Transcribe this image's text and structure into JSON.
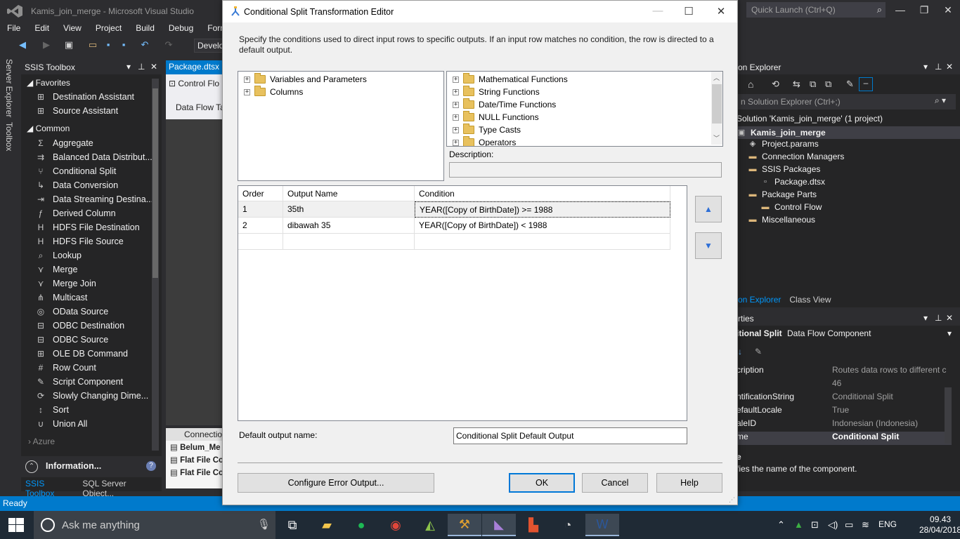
{
  "vs": {
    "title": "Kamis_join_merge - Microsoft Visual Studio",
    "quick_launch_placeholder": "Quick Launch (Ctrl+Q)",
    "menu": [
      "File",
      "Edit",
      "View",
      "Project",
      "Build",
      "Debug",
      "Form"
    ],
    "toolbar_config": "Develo",
    "side_tabs": [
      "Server Explorer",
      "Toolbox"
    ],
    "status": "Ready"
  },
  "toolbox": {
    "title": "SSIS Toolbox",
    "favorites_label": "Favorites",
    "favorites": [
      "Destination Assistant",
      "Source Assistant"
    ],
    "common_label": "Common",
    "common": [
      "Aggregate",
      "Balanced Data Distribut...",
      "Conditional Split",
      "Data Conversion",
      "Data Streaming Destina...",
      "Derived Column",
      "HDFS File Destination",
      "HDFS File Source",
      "Lookup",
      "Merge",
      "Merge Join",
      "Multicast",
      "OData Source",
      "ODBC Destination",
      "ODBC Source",
      "OLE DB Command",
      "Row Count",
      "Script Component",
      "Slowly Changing Dime...",
      "Sort",
      "Union All"
    ],
    "azure_label": "Azure",
    "info_label": "Information...",
    "bottom_tabs": [
      "SSIS Toolbox",
      "SQL Server Object..."
    ]
  },
  "package": {
    "tab": "Package.dtsx [",
    "control_flow": "Control Flo",
    "data_flow": "Data Flow Ta",
    "connections_label": "Connection",
    "connections": [
      "Belum_Me",
      "Flat File Co",
      "Flat File Co"
    ]
  },
  "solution": {
    "title": "on Explorer",
    "search_placeholder": "n Solution Explorer (Ctrl+;)",
    "items": [
      {
        "label": "Solution 'Kamis_join_merge' (1 project)"
      },
      {
        "label": "Kamis_join_merge"
      },
      {
        "label": "Project.params"
      },
      {
        "label": "Connection Managers"
      },
      {
        "label": "SSIS Packages"
      },
      {
        "label": "Package.dtsx"
      },
      {
        "label": "Package Parts"
      },
      {
        "label": "Control Flow"
      },
      {
        "label": "Miscellaneous"
      }
    ],
    "tabs": [
      "on Explorer",
      "Class View"
    ]
  },
  "properties": {
    "title": "rties",
    "object_name": "itional Split",
    "object_type": "Data Flow Component",
    "rows": [
      {
        "name": "cription",
        "value": "Routes data rows to different c"
      },
      {
        "name": "",
        "value": "46"
      },
      {
        "name": "ntificationString",
        "value": "Conditional Split"
      },
      {
        "name": "efaultLocale",
        "value": "True"
      },
      {
        "name": "aleID",
        "value": "Indonesian (Indonesia)"
      },
      {
        "name": "me",
        "value": "Conditional Split"
      }
    ],
    "help_title": "e",
    "help_text": "fies the name of the component."
  },
  "taskbar": {
    "search_placeholder": "Ask me anything",
    "lang": "ENG",
    "time": "09.43",
    "date": "28/04/2018"
  },
  "dialog": {
    "title": "Conditional Split Transformation Editor",
    "description": "Specify the conditions used to direct input rows to specific outputs. If an input row matches no condition, the row is directed to a default output.",
    "left_tree": [
      "Variables and Parameters",
      "Columns"
    ],
    "right_tree": [
      "Mathematical Functions",
      "String Functions",
      "Date/Time Functions",
      "NULL Functions",
      "Type Casts",
      "Operators"
    ],
    "description_label": "Description:",
    "grid_headers": [
      "Order",
      "Output Name",
      "Condition"
    ],
    "grid_rows": [
      {
        "order": "1",
        "name": "35th",
        "condition": "YEAR([Copy of BirthDate]) >= 1988"
      },
      {
        "order": "2",
        "name": "dibawah 35",
        "condition": "YEAR([Copy of BirthDate]) < 1988"
      }
    ],
    "default_output_label": "Default output name:",
    "default_output_value": "Conditional Split Default Output",
    "buttons": {
      "configure": "Configure Error Output...",
      "ok": "OK",
      "cancel": "Cancel",
      "help": "Help"
    }
  }
}
